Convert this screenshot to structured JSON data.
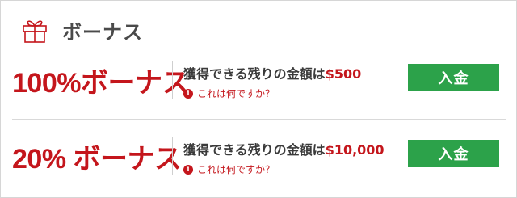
{
  "header": {
    "title": "ボーナス",
    "icon": "gift-icon"
  },
  "bonuses": [
    {
      "label": "100%ボーナス",
      "remaining_text": "獲得できる残りの金額は",
      "amount": "$500",
      "help_text": "これは何ですか？",
      "button_label": "入金"
    },
    {
      "label": "20% ボーナス",
      "remaining_text": "獲得できる残りの金額は",
      "amount": "$10,000",
      "help_text": "これは何ですか？",
      "button_label": "入金"
    }
  ],
  "colors": {
    "accent_red": "#c4161c",
    "button_green": "#2ca24a",
    "heading_gray": "#4a4a4a"
  }
}
